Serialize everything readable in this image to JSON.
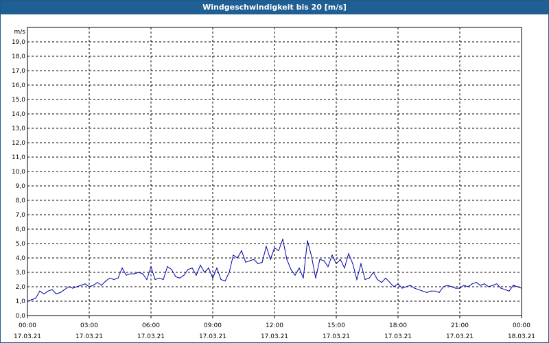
{
  "window": {
    "title": "Windgeschwindigkeit bis 20 [m/s]"
  },
  "chart_data": {
    "type": "line",
    "title": "Windgeschwindigkeit bis 20 [m/s]",
    "ylabel": "m/s",
    "xlabel": "",
    "ylim": [
      0,
      20
    ],
    "xlim_hours": [
      0,
      24
    ],
    "grid": true,
    "y_ticks": [
      "0,0",
      "1,0",
      "2,0",
      "3,0",
      "4,0",
      "5,0",
      "6,0",
      "7,0",
      "8,0",
      "9,0",
      "10,0",
      "11,0",
      "12,0",
      "13,0",
      "14,0",
      "15,0",
      "16,0",
      "17,0",
      "18,0",
      "19,0"
    ],
    "x_ticks": [
      {
        "time": "00:00",
        "date": "17.03.21"
      },
      {
        "time": "03:00",
        "date": "17.03.21"
      },
      {
        "time": "06:00",
        "date": "17.03.21"
      },
      {
        "time": "09:00",
        "date": "17.03.21"
      },
      {
        "time": "12:00",
        "date": "17.03.21"
      },
      {
        "time": "15:00",
        "date": "17.03.21"
      },
      {
        "time": "18:00",
        "date": "17.03.21"
      },
      {
        "time": "21:00",
        "date": "17.03.21"
      },
      {
        "time": "00:00",
        "date": "18.03.21"
      }
    ],
    "series_color": "#0000aa",
    "series": [
      {
        "x_hours": [
          0.0,
          0.2,
          0.4,
          0.6,
          0.8,
          1.0,
          1.2,
          1.4,
          1.6,
          1.8,
          2.0,
          2.2,
          2.4,
          2.6,
          2.8,
          3.0,
          3.2,
          3.4,
          3.6,
          3.8,
          4.0,
          4.2,
          4.4,
          4.6,
          4.8,
          5.0,
          5.2,
          5.4,
          5.6,
          5.8,
          6.0,
          6.2,
          6.4,
          6.6,
          6.8,
          7.0,
          7.2,
          7.4,
          7.6,
          7.8,
          8.0,
          8.2,
          8.4,
          8.6,
          8.8,
          9.0,
          9.2,
          9.4,
          9.6,
          9.8,
          10.0,
          10.2,
          10.4,
          10.6,
          10.8,
          11.0,
          11.2,
          11.4,
          11.6,
          11.8,
          12.0,
          12.2,
          12.4,
          12.6,
          12.8,
          13.0,
          13.2,
          13.4,
          13.6,
          13.8,
          14.0,
          14.2,
          14.4,
          14.6,
          14.8,
          15.0,
          15.2,
          15.4,
          15.6,
          15.8,
          16.0,
          16.2,
          16.4,
          16.6,
          16.8,
          17.0,
          17.2,
          17.4,
          17.6,
          17.8,
          18.0,
          18.2,
          18.4,
          18.6,
          18.8,
          19.0,
          19.2,
          19.4,
          19.6,
          19.8,
          20.0,
          20.2,
          20.4,
          20.6,
          20.8,
          21.0,
          21.2,
          21.4,
          21.6,
          21.8,
          22.0,
          22.2,
          22.4,
          22.6,
          22.8,
          23.0,
          23.2,
          23.4,
          23.6,
          23.8,
          24.0
        ],
        "values": [
          1.0,
          1.1,
          1.2,
          1.7,
          1.5,
          1.7,
          1.8,
          1.5,
          1.6,
          1.8,
          2.0,
          1.9,
          2.0,
          2.1,
          2.2,
          2.0,
          2.1,
          2.3,
          2.1,
          2.4,
          2.6,
          2.5,
          2.6,
          3.3,
          2.8,
          2.9,
          2.9,
          3.0,
          2.9,
          2.5,
          3.4,
          2.5,
          2.6,
          2.5,
          3.4,
          3.2,
          2.7,
          2.6,
          2.8,
          3.2,
          3.3,
          2.8,
          3.5,
          3.0,
          3.3,
          2.6,
          3.3,
          2.5,
          2.4,
          3.0,
          4.2,
          4.0,
          4.5,
          3.7,
          3.8,
          3.9,
          3.6,
          3.7,
          4.8,
          3.9,
          4.7,
          4.5,
          5.3,
          3.9,
          3.2,
          2.8,
          3.3,
          2.6,
          5.2,
          4.1,
          2.6,
          3.9,
          3.8,
          3.4,
          4.2,
          3.6,
          3.9,
          3.3,
          4.3,
          3.6,
          2.5,
          3.6,
          2.5,
          2.6,
          3.0,
          2.5,
          2.3,
          2.6,
          2.3,
          2.0,
          2.2,
          1.9,
          2.0,
          2.1,
          1.9,
          1.8,
          1.7,
          1.6,
          1.7,
          1.7,
          1.6,
          2.0,
          2.1,
          2.0,
          1.9,
          1.9,
          2.1,
          2.0,
          2.2,
          2.3,
          2.1,
          2.2,
          2.0,
          2.1,
          2.2,
          1.9,
          1.8,
          1.7,
          2.1,
          2.0,
          1.9
        ]
      }
    ]
  }
}
